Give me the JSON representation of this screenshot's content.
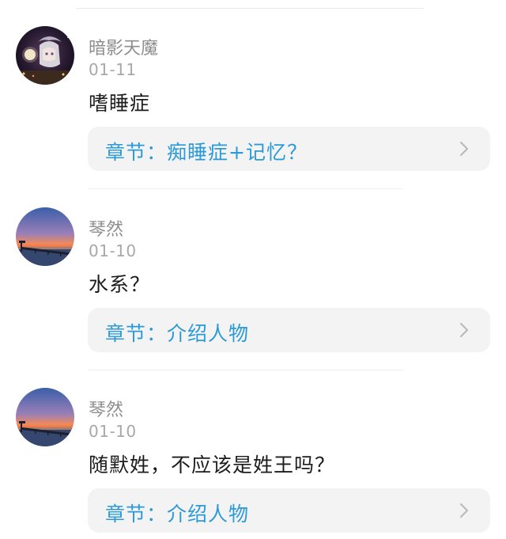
{
  "comments": [
    {
      "username": "暗影天魔",
      "date": "01-11",
      "content": "嗜睡症",
      "chapter": "章节：痴睡症+记忆？",
      "avatar_icon": "anime-character-avatar"
    },
    {
      "username": "琴然",
      "date": "01-10",
      "content": "水系？",
      "chapter": "章节：介绍人物",
      "avatar_icon": "sunset-pier-avatar"
    },
    {
      "username": "琴然",
      "date": "01-10",
      "content": "随默姓，不应该是姓王吗？",
      "chapter": "章节：介绍人物",
      "avatar_icon": "sunset-pier-avatar"
    }
  ],
  "colors": {
    "chapter_link": "#2b9ad6",
    "card_bg": "#f3f3f4",
    "username": "#8e8e8e",
    "date": "#a8a8a8",
    "content": "#1c1c1c"
  }
}
